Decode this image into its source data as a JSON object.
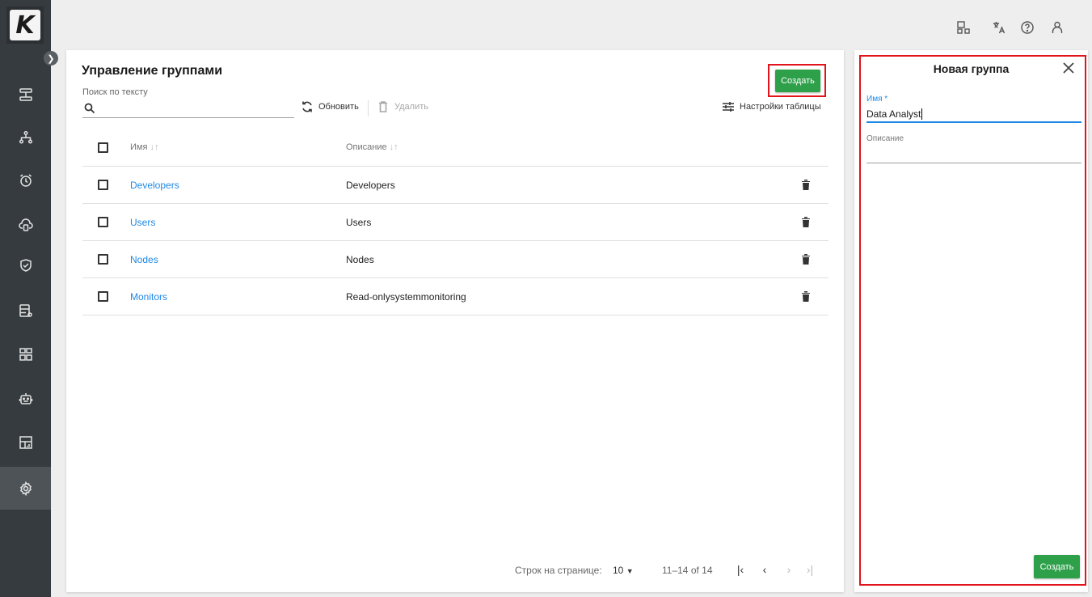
{
  "logo_letter": "K",
  "page": {
    "title": "Управление группами",
    "search_label": "Поиск по тексту",
    "search_value": "",
    "refresh_label": "Обновить",
    "delete_label": "Удалить",
    "table_settings_label": "Настройки таблицы",
    "create_label": "Создать"
  },
  "table": {
    "headers": {
      "name": "Имя",
      "description": "Описание",
      "sort_glyph": "↓↑"
    },
    "rows": [
      {
        "name": "Developers",
        "description": "Developers"
      },
      {
        "name": "Users",
        "description": "Users"
      },
      {
        "name": "Nodes",
        "description": "Nodes"
      },
      {
        "name": "Monitors",
        "description": "Read-onlysystemmonitoring"
      }
    ]
  },
  "pagination": {
    "rows_per_page_label": "Строк на странице:",
    "rows_per_page_value": "10",
    "range": "11–14 of 14"
  },
  "panel": {
    "title": "Новая группа",
    "name_label": "Имя *",
    "name_value": "Data Analyst",
    "description_label": "Описание",
    "description_value": "",
    "create_label": "Создать"
  },
  "colors": {
    "accent_green": "#2ea04a",
    "link_blue": "#1e88e5",
    "highlight_red": "#e1141b",
    "sidebar": "#363b3f"
  },
  "icons": {
    "sidebar": [
      "topology-icon",
      "hierarchy-icon",
      "alarm-icon",
      "cloud-database-icon",
      "shield-check-icon",
      "database-settings-icon",
      "widgets-icon",
      "robot-icon",
      "dashboard-chart-icon",
      "gear-icon"
    ],
    "topbar": [
      "dashboard-layout-icon",
      "translate-icon",
      "help-icon",
      "user-icon"
    ]
  }
}
